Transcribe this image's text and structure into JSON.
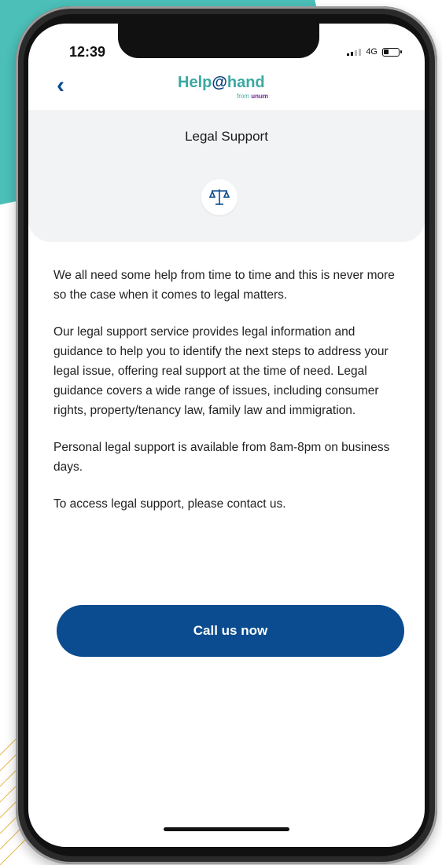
{
  "status_bar": {
    "time": "12:39",
    "network": "4G"
  },
  "header": {
    "logo_main": "Help",
    "logo_at": "@",
    "logo_rest": "hand",
    "logo_sub_prefix": "from",
    "logo_sub_brand": "unum"
  },
  "card": {
    "title": "Legal Support",
    "icon": "scales-icon"
  },
  "body": {
    "paragraphs": [
      "We all need some help from time to time and this is never more so the case when it comes to legal matters.",
      "Our legal support service provides legal information and guidance to help you to identify the next steps to address your legal issue, offering real support at the time of need. Legal guidance covers a wide range of issues, including consumer rights, property/tenancy law, family law and immigration.",
      "Personal legal support is available from 8am-8pm on business days.",
      "To access legal support, please contact us."
    ]
  },
  "actions": {
    "call_label": "Call us now"
  },
  "colors": {
    "primary": "#0a4c8f",
    "accent_teal": "#3aa9a2",
    "card_bg": "#f1f3f5",
    "blob_teal": "#4bbfb8"
  }
}
